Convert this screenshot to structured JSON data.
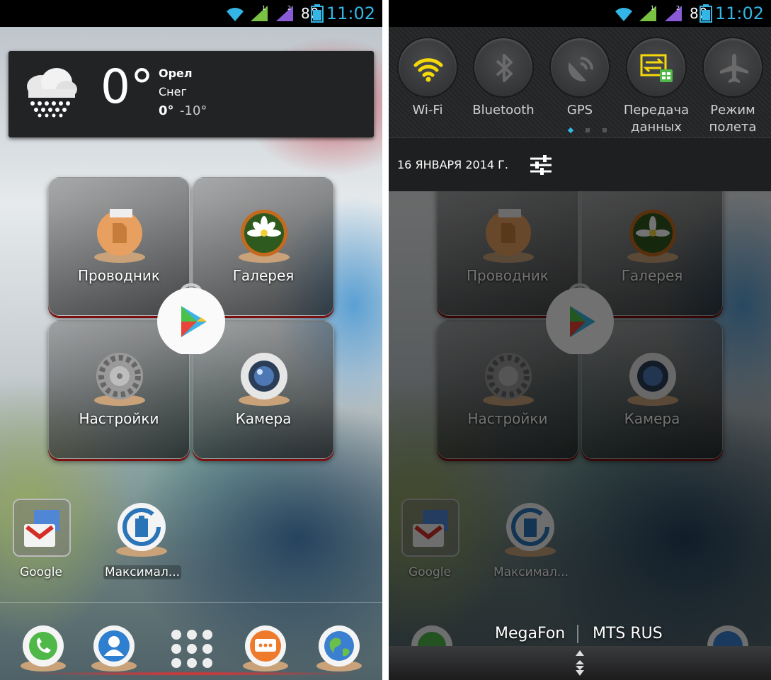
{
  "status_bar": {
    "battery_level": "80",
    "time": "11:02",
    "icons": [
      "wifi-icon",
      "signal-sim1-icon",
      "signal-sim2-icon",
      "battery-icon"
    ],
    "time_color": "#33b5e5"
  },
  "weather": {
    "temperature": "0°",
    "city": "Орел",
    "condition": "Снег",
    "high": "0°",
    "low": "-10°",
    "icon": "snow-cloud-icon"
  },
  "folder_apps": [
    {
      "label": "Проводник",
      "icon": "file-manager-icon"
    },
    {
      "label": "Галерея",
      "icon": "gallery-icon"
    },
    {
      "label": "Настройки",
      "icon": "settings-gear-icon"
    },
    {
      "label": "Камера",
      "icon": "camera-icon"
    }
  ],
  "center_icon": "play-store-icon",
  "shortcuts": [
    {
      "label": "Google",
      "icon": "google-folder-icon"
    },
    {
      "label": "Максимал...",
      "icon": "battery-saver-icon"
    }
  ],
  "dock": [
    "phone-icon",
    "contacts-icon",
    "app-drawer-icon",
    "messages-icon",
    "browser-icon"
  ],
  "quick_settings": [
    {
      "label": "Wi-Fi",
      "icon": "wifi-icon",
      "active": true
    },
    {
      "label": "Bluetooth",
      "icon": "bluetooth-icon",
      "active": false
    },
    {
      "label": "GPS",
      "icon": "gps-icon",
      "active": false
    },
    {
      "label": "Передача данных",
      "label_line1": "Передача",
      "label_line2": "данных",
      "icon": "data-transfer-icon",
      "active": true
    },
    {
      "label": "Режим полета",
      "label_line1": "Режим",
      "label_line2": "полета",
      "icon": "airplane-icon",
      "active": false
    }
  ],
  "shade": {
    "date": "16 ЯНВАРЯ 2014 Г.",
    "carrier_1": "MegaFon",
    "carrier_2": "MTS RUS"
  },
  "colors": {
    "accent_blue": "#33b5e5",
    "wifi_active": "#f5d90a",
    "data_active": "#f5d90a",
    "tile_red_edge": "#7a1010"
  }
}
